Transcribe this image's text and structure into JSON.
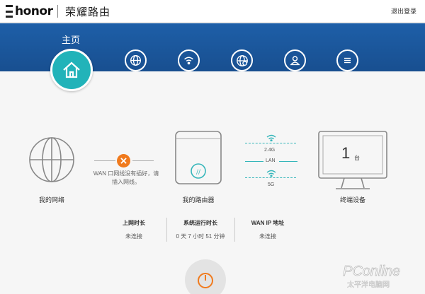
{
  "header": {
    "brand": "honor",
    "app_title": "荣耀路由",
    "logout": "退出登录"
  },
  "banner": {
    "home_label": "主页",
    "nav_icons": [
      "home-icon",
      "globe-icon",
      "wifi-icon",
      "network-icon",
      "user-icon",
      "menu-icon"
    ]
  },
  "network": {
    "label": "我的网络",
    "wan_status_lines": [
      "WAN 口网线没有插好，请",
      "插入网线。"
    ]
  },
  "router": {
    "label": "我的路由器",
    "band_top": "2.4G",
    "band_mid": "LAN",
    "band_bottom": "5G"
  },
  "devices": {
    "count": "1",
    "unit": "台",
    "label": "终端设备"
  },
  "stats": [
    {
      "title": "上网时长",
      "value": "未连接"
    },
    {
      "title": "系统运行时长",
      "value": "0 天 7 小时 51 分钟"
    },
    {
      "title": "WAN IP 地址",
      "value": "未连接"
    }
  ],
  "watermark": {
    "line1": "PConline",
    "line2": "太平洋电脑网"
  },
  "colors": {
    "banner": "#1e5fa8",
    "accent_teal": "#22b3b9",
    "error_orange": "#f07a1d",
    "wifi_teal": "#35b6ba"
  }
}
